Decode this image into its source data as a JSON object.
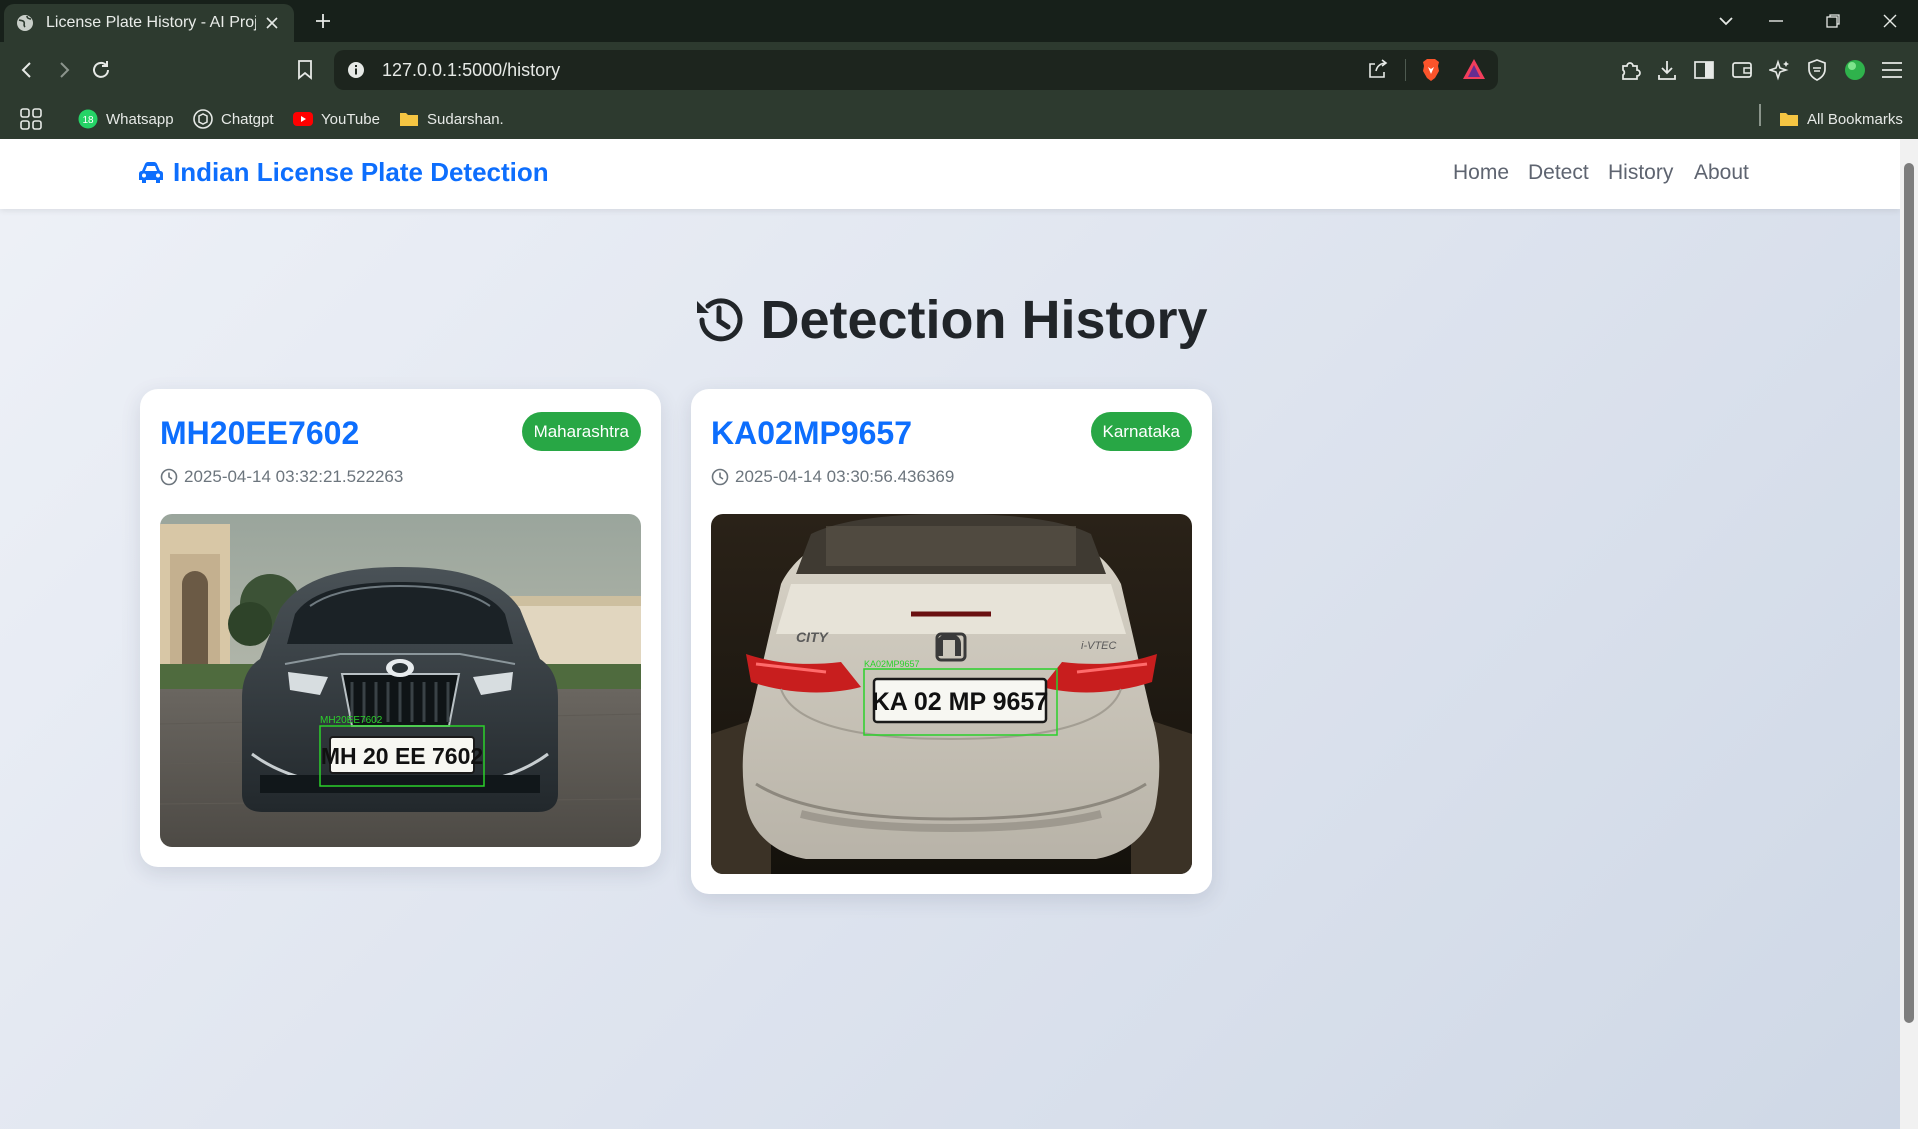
{
  "browser": {
    "tab_title": "License Plate History - AI Projec",
    "url": "127.0.0.1:5000/history",
    "bookmarks": [
      {
        "label": "Whatsapp",
        "badge": "18",
        "icon": "whatsapp-icon"
      },
      {
        "label": "Chatgpt",
        "icon": "chatgpt-icon"
      },
      {
        "label": "YouTube",
        "icon": "youtube-icon"
      },
      {
        "label": "Sudarshan.",
        "icon": "folder-icon"
      }
    ],
    "all_bookmarks": "All Bookmarks"
  },
  "site": {
    "brand": "Indian License Plate Detection",
    "nav": [
      "Home",
      "Detect",
      "History",
      "About"
    ],
    "accent": "#0d6efd",
    "badge_color": "#28a745"
  },
  "main": {
    "heading": "Detection History",
    "cards": [
      {
        "plate": "MH20EE7602",
        "state": "Maharashtra",
        "timestamp": "2025-04-14 03:32:21.522263",
        "image": {
          "overlay_label": "MH20EE7602",
          "plate_text": "MH 20 EE 7602"
        }
      },
      {
        "plate": "KA02MP9657",
        "state": "Karnataka",
        "timestamp": "2025-04-14 03:30:56.436369",
        "image": {
          "overlay_label": "KA02MP9657",
          "plate_text": "KA 02 MP 9657",
          "badge_text": "CITY",
          "trim_text": "i-VTEC"
        }
      }
    ]
  }
}
